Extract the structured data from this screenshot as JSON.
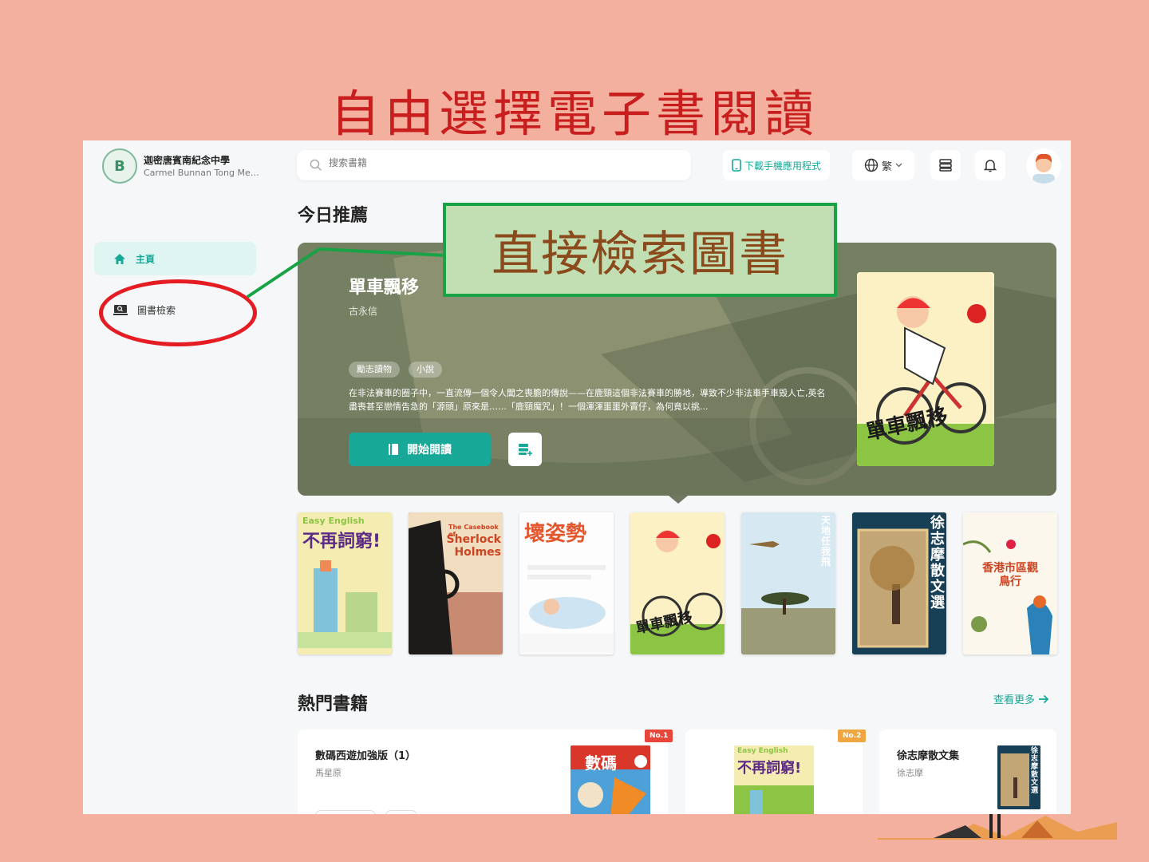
{
  "slide": {
    "title": "自由選擇電子書閱讀",
    "callout": "直接檢索圖書"
  },
  "app": {
    "school_name": "迦密唐賓南紀念中學",
    "school_name_en": "Carmel Bunnan Tong Memori...",
    "logo_letter": "B",
    "search": {
      "placeholder": "搜索書籍"
    },
    "download_app": "下載手機應用程式",
    "language": "繁"
  },
  "sidebar": {
    "items": [
      {
        "label": "主頁",
        "active": true
      },
      {
        "label": "圖書檢索",
        "active": false
      }
    ]
  },
  "today": {
    "section_title": "今日推薦",
    "book": {
      "title": "單車飄移",
      "author": "古永信",
      "tags": [
        "勵志讀物",
        "小說"
      ],
      "description": "在非法賽車的圈子中，一直流傳一個令人聞之喪膽的傳說——在鹿頸這個非法賽車的勝地，導致不少非法車手車毀人亡,英名盡喪甚至戀情告急的「源頭」原來是……「鹿頸魔咒」！一個渾渾噩噩外賣仔，為何竟以挑...",
      "read_button": "開始閱讀",
      "cover_text": "單車飄移"
    },
    "carousel": [
      {
        "title": "不再詞窮!",
        "subtitle": "Easy English"
      },
      {
        "title": "Sherlock Holmes",
        "subtitle": "The Casebook of"
      },
      {
        "title": "壞姿勢",
        "subtitle": ""
      },
      {
        "title": "單車飄移",
        "subtitle": ""
      },
      {
        "title": "天地任我飛",
        "subtitle": ""
      },
      {
        "title": "徐志摩散文選",
        "subtitle": ""
      },
      {
        "title": "香港市區觀鳥行",
        "subtitle": ""
      }
    ]
  },
  "popular": {
    "section_title": "熱門書籍",
    "more_link": "查看更多",
    "items": [
      {
        "rank": "No.1",
        "title": "數碼西遊加強版（1）",
        "author": "馬星原",
        "cover_text": "數碼"
      },
      {
        "rank": "No.2",
        "title": "",
        "author": "",
        "cover_text": "不再詞窮!"
      },
      {
        "rank": "",
        "title": "徐志摩散文集",
        "author": "徐志摩",
        "cover_text": "徐志摩散文選"
      }
    ]
  },
  "colors": {
    "background": "#f4b09e",
    "accent": "#17a898",
    "slide_title": "#c81e1e",
    "callout_border": "#18a346",
    "highlight_ring": "#e51c23"
  },
  "icons": [
    "search-icon",
    "phone-icon",
    "globe-icon",
    "chevron-down-icon",
    "bookshelf-icon",
    "bell-icon",
    "user-avatar",
    "home-icon",
    "library-search-icon",
    "book-icon",
    "add-shelf-icon",
    "arrow-right-icon"
  ]
}
